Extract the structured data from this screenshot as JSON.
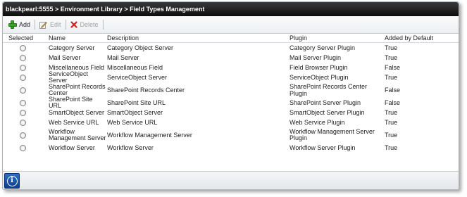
{
  "window": {
    "breadcrumb": "blackpearl:5555 > Environment Library > Field Types Management"
  },
  "toolbar": {
    "add_label": "Add",
    "edit_label": "Edit",
    "delete_label": "Delete"
  },
  "grid": {
    "columns": [
      "Selected",
      "Name",
      "Description",
      "Plugin",
      "Added by Default"
    ],
    "rows": [
      {
        "name": "Category Server",
        "description": "Category Object Server",
        "plugin": "Category Server Plugin",
        "default": "True"
      },
      {
        "name": "Mail Server",
        "description": "Mail Server",
        "plugin": "Mail Server Plugin",
        "default": "True"
      },
      {
        "name": "Miscellaneous Field",
        "description": "Miscellaneous Field",
        "plugin": "Field Browser Plugin",
        "default": "False"
      },
      {
        "name": "ServiceObject Server",
        "description": "ServiceObject Server",
        "plugin": "ServiceObject Plugin",
        "default": "True"
      },
      {
        "name": "SharePoint Records Center",
        "description": "SharePoint Records Center",
        "plugin": "SharePoint Records Center Plugin",
        "default": "False"
      },
      {
        "name": "SharePoint Site URL",
        "description": "SharePoint Site URL",
        "plugin": "SharePoint Server Plugin",
        "default": "False"
      },
      {
        "name": "SmartObject Server",
        "description": "SmartObject Server",
        "plugin": "SmartObject Server Plugin",
        "default": "True"
      },
      {
        "name": "Web Service URL",
        "description": "Web Service URL",
        "plugin": "Web Service Plugin",
        "default": "True"
      },
      {
        "name": "Workflow Management Server",
        "description": "Workflow Management Server",
        "plugin": "Workflow Management Server Plugin",
        "default": "True"
      },
      {
        "name": "Workflow Server",
        "description": "Workflow Server",
        "plugin": "Workflow Server Plugin",
        "default": "True"
      }
    ]
  },
  "colors": {
    "titlebar": "#0d0d0d",
    "add_icon": "#3aa227",
    "delete_icon": "#d21e1e",
    "info_button": "#0b3f8f"
  },
  "icons": {
    "add": "plus-icon",
    "edit": "edit-icon",
    "delete": "delete-x-icon",
    "info": "info-icon"
  }
}
